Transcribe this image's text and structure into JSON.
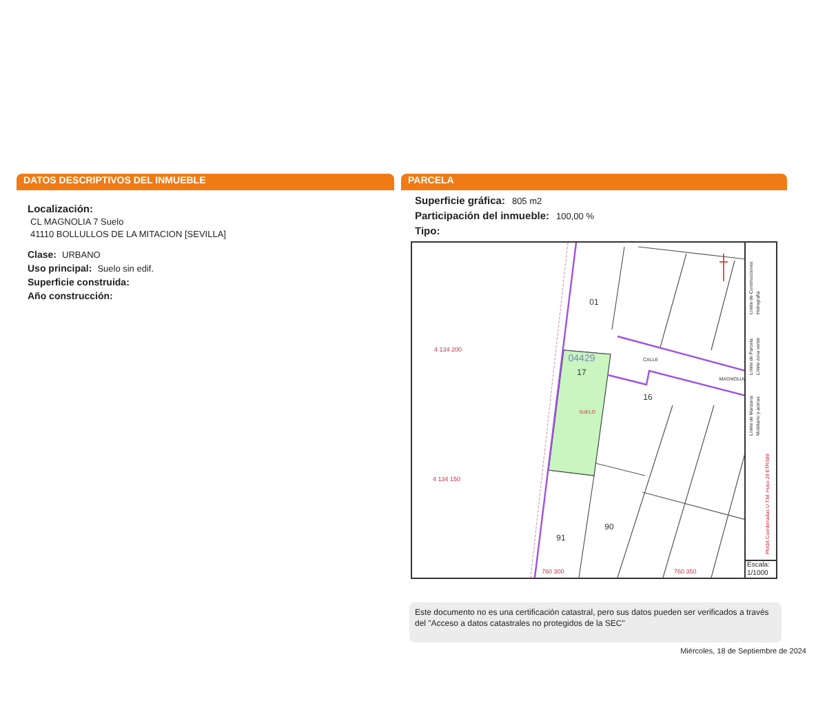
{
  "left_panel": {
    "title": "DATOS DESCRIPTIVOS DEL INMUEBLE",
    "location_label": "Localización:",
    "address_lines": [
      "CL MAGNOLIA 7 Suelo",
      "41110 BOLLULLOS DE LA MITACION [SEVILLA]"
    ],
    "fields": [
      {
        "label": "Clase:",
        "value": "URBANO"
      },
      {
        "label": "Uso principal:",
        "value": "Suelo sin edif."
      },
      {
        "label": "Superficie construida:"
      },
      {
        "label": "Año construcción:"
      }
    ]
  },
  "right_panel": {
    "title": "PARCELA",
    "fields": [
      {
        "label": "Superficie gráfica:",
        "value": "805 m2"
      },
      {
        "label": "Participación del inmueble:",
        "value": "100,00 %"
      },
      {
        "label": "Tipo:"
      }
    ],
    "map": {
      "labels": [
        {
          "kind": "parcel",
          "text": "01"
        },
        {
          "kind": "block",
          "text": "04429"
        },
        {
          "kind": "parcel",
          "text": "17"
        },
        {
          "kind": "use",
          "text": "SUELO"
        },
        {
          "kind": "street",
          "text": "CALLE"
        },
        {
          "kind": "street",
          "text": "MAGNOLIA"
        },
        {
          "kind": "parcel",
          "text": "16"
        },
        {
          "kind": "parcel",
          "text": "91"
        },
        {
          "kind": "parcel",
          "text": "90"
        },
        {
          "kind": "coord",
          "text": "4 134 200"
        },
        {
          "kind": "coord",
          "text": "4 134 150"
        },
        {
          "kind": "coord",
          "text": "760 300"
        },
        {
          "kind": "coord",
          "text": "760 350"
        }
      ],
      "legend": [
        "Límite de Manzana",
        "Límite de Parcela",
        "Límite de Construcciones",
        "Mobiliario y aceras",
        "Límite zona verde",
        "Hidrografía"
      ],
      "crs_note": "PNOA Coordenadas U.T.M. Huso 29 ETRS89",
      "scale_label": "Escala:",
      "scale": "1/1000"
    }
  },
  "notice": "Este documento no es una certificación catastral, pero sus datos pueden ser verificados a través del \"Acceso a datos catastrales no protegidos de la SEC\"",
  "date": "Miércoles, 18 de Septiembre de 2024"
}
